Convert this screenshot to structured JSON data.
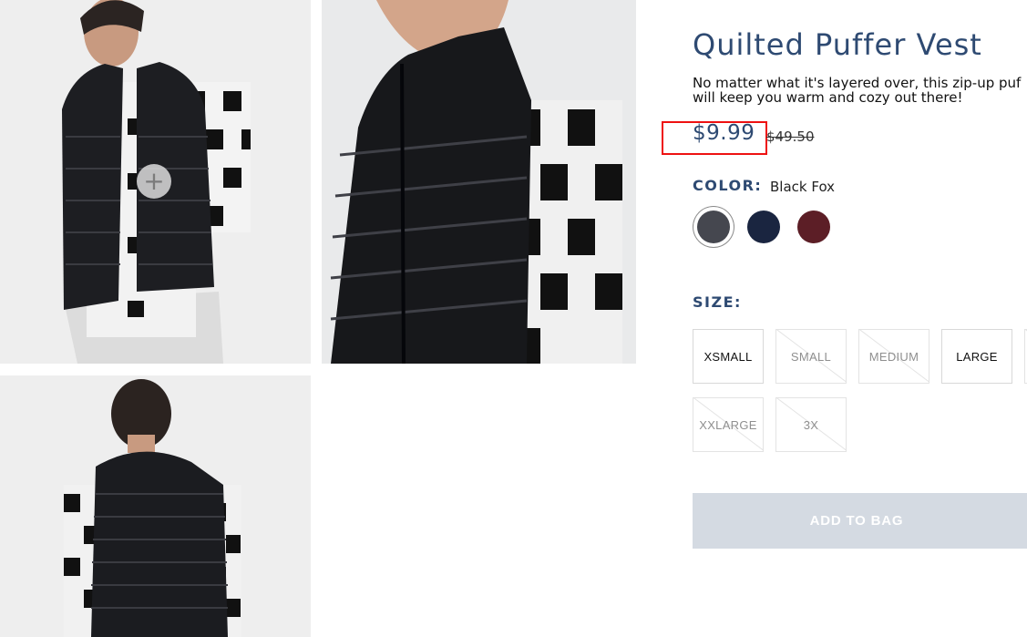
{
  "product": {
    "title": "Quilted Puffer Vest",
    "description_line1": "No matter what it's layered over, this zip-up puf",
    "description_line2": "will keep you warm and cozy out there!",
    "price": "$9.99",
    "original_price": "$49.50"
  },
  "gallery": {
    "zoom_symbol": "+",
    "images": [
      {
        "description": "model front"
      },
      {
        "description": "detail close-up"
      },
      {
        "description": "model back"
      }
    ]
  },
  "color": {
    "label": "COLOR:",
    "selected": "Black Fox",
    "swatches": [
      {
        "name": "Black Fox",
        "hex": "#45474f",
        "selected": true
      },
      {
        "name": "Navy",
        "hex": "#1a2540",
        "selected": false
      },
      {
        "name": "Burgundy",
        "hex": "#5c1e26",
        "selected": false
      }
    ]
  },
  "size": {
    "label": "SIZE:",
    "options": [
      {
        "label": "XSMALL",
        "available": true
      },
      {
        "label": "SMALL",
        "available": false
      },
      {
        "label": "MEDIUM",
        "available": false
      },
      {
        "label": "LARGE",
        "available": true
      },
      {
        "label": "XXLARGE",
        "available": false
      },
      {
        "label": "3X",
        "available": false
      }
    ]
  },
  "cart": {
    "add_label": "ADD TO BAG"
  },
  "colors": {
    "accent": "#2e4a72",
    "highlight": "#e11111",
    "disabled_button": "#d4dae2"
  }
}
